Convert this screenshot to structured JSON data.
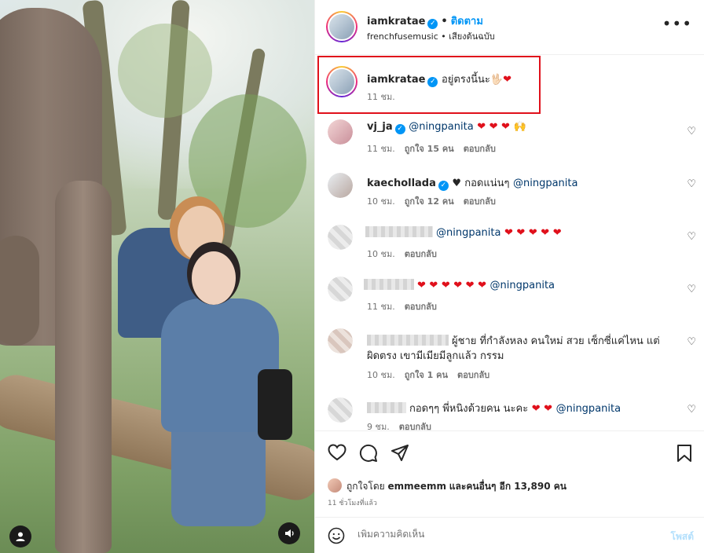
{
  "header": {
    "username": "iamkratae",
    "separator": "•",
    "follow_label": "ติดตาม",
    "audio_source": "frenchfusemusic",
    "audio_label": "เสียงต้นฉบับ",
    "more_icon": "more-icon"
  },
  "caption": {
    "username": "iamkratae",
    "text": "อยู่ตรงนี้นะ🖖🏻",
    "heart": "❤",
    "time": "11 ชม."
  },
  "comments": [
    {
      "username": "vj_ja",
      "mention": "@ningpanita",
      "text": "",
      "hearts": "❤ ❤ ❤",
      "extra_emoji": "🙌",
      "time": "11 ชม.",
      "likes": "ถูกใจ 15 คน",
      "reply": "ตอบกลับ"
    },
    {
      "username": "kaechollada",
      "pre_text": "♥ กอดแน่นๆ",
      "mention": "@ningpanita",
      "time": "10 ชม.",
      "likes": "ถูกใจ 12 คน",
      "reply": "ตอบกลับ"
    },
    {
      "mention": "@ningpanita",
      "hearts": "❤ ❤ ❤ ❤ ❤",
      "time": "10 ชม.",
      "reply": "ตอบกลับ"
    },
    {
      "hearts": "❤ ❤ ❤ ❤ ❤ ❤",
      "mention": "@ningpanita",
      "time": "11 ชม.",
      "reply": "ตอบกลับ"
    },
    {
      "text_line1": "ผู้ชาย ที่กำลังหลง คนใหม่ สวย เซ็กซี่แค่ไหน แต่",
      "text_line2": "ผิดตรง เขามีเมียมีลูกแล้ว กรรม",
      "time": "10 ชม.",
      "likes": "ถูกใจ 1 คน",
      "reply": "ตอบกลับ"
    },
    {
      "pre_text": "กอดๆๆ พี่หนิงด้วยคน นะคะ",
      "hearts": "❤ ❤",
      "mention": "@ningpanita",
      "time": "9 ชม.",
      "reply": "ตอบกลับ"
    }
  ],
  "actions": {
    "liked_by_prefix": "ถูกใจโดย",
    "liked_by_user": "emmeemm",
    "and_label": "และ",
    "others_label": "คนอื่นๆ อีก 13,890 คน",
    "time_ago": "11 ชั่วโมงที่แล้ว"
  },
  "add_comment": {
    "placeholder": "เพิ่มความคิดเห็น",
    "post_label": "โพสต์"
  },
  "colors": {
    "accent": "#0095f6",
    "highlight_box": "#e0101b",
    "heart": "#e0101b"
  }
}
